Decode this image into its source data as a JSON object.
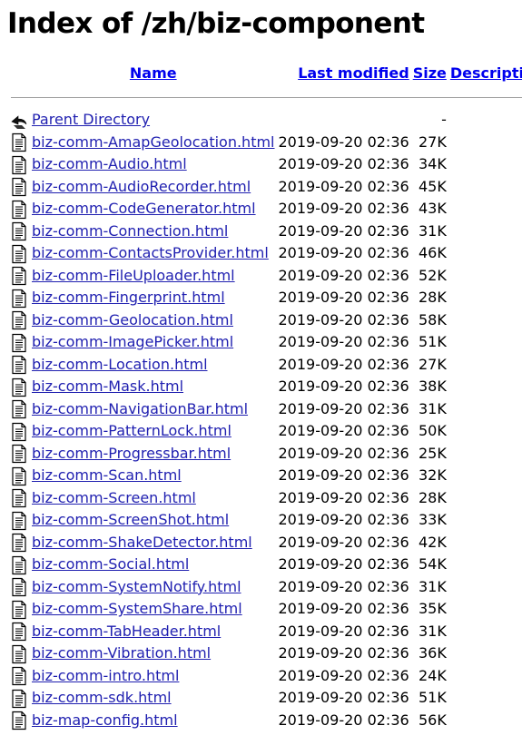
{
  "page": {
    "title": "Index of /zh/biz-component"
  },
  "columns": {
    "name": "Name",
    "last_modified": "Last modified",
    "size": "Size",
    "description": "Description"
  },
  "parent": {
    "label": "Parent Directory",
    "date": "",
    "size": "-",
    "icon": "back-arrow-icon"
  },
  "entries": [
    {
      "name": "biz-comm-AmapGeolocation.html",
      "date": "2019-09-20 02:36",
      "size": "27K",
      "icon": "text-file-icon"
    },
    {
      "name": "biz-comm-Audio.html",
      "date": "2019-09-20 02:36",
      "size": "34K",
      "icon": "text-file-icon"
    },
    {
      "name": "biz-comm-AudioRecorder.html",
      "date": "2019-09-20 02:36",
      "size": "45K",
      "icon": "text-file-icon"
    },
    {
      "name": "biz-comm-CodeGenerator.html",
      "date": "2019-09-20 02:36",
      "size": "43K",
      "icon": "text-file-icon"
    },
    {
      "name": "biz-comm-Connection.html",
      "date": "2019-09-20 02:36",
      "size": "31K",
      "icon": "text-file-icon"
    },
    {
      "name": "biz-comm-ContactsProvider.html",
      "date": "2019-09-20 02:36",
      "size": "46K",
      "icon": "text-file-icon"
    },
    {
      "name": "biz-comm-FileUploader.html",
      "date": "2019-09-20 02:36",
      "size": "52K",
      "icon": "text-file-icon"
    },
    {
      "name": "biz-comm-Fingerprint.html",
      "date": "2019-09-20 02:36",
      "size": "28K",
      "icon": "text-file-icon"
    },
    {
      "name": "biz-comm-Geolocation.html",
      "date": "2019-09-20 02:36",
      "size": "58K",
      "icon": "text-file-icon"
    },
    {
      "name": "biz-comm-ImagePicker.html",
      "date": "2019-09-20 02:36",
      "size": "51K",
      "icon": "text-file-icon"
    },
    {
      "name": "biz-comm-Location.html",
      "date": "2019-09-20 02:36",
      "size": "27K",
      "icon": "text-file-icon"
    },
    {
      "name": "biz-comm-Mask.html",
      "date": "2019-09-20 02:36",
      "size": "38K",
      "icon": "text-file-icon"
    },
    {
      "name": "biz-comm-NavigationBar.html",
      "date": "2019-09-20 02:36",
      "size": "31K",
      "icon": "text-file-icon"
    },
    {
      "name": "biz-comm-PatternLock.html",
      "date": "2019-09-20 02:36",
      "size": "50K",
      "icon": "text-file-icon"
    },
    {
      "name": "biz-comm-Progressbar.html",
      "date": "2019-09-20 02:36",
      "size": "25K",
      "icon": "text-file-icon"
    },
    {
      "name": "biz-comm-Scan.html",
      "date": "2019-09-20 02:36",
      "size": "32K",
      "icon": "text-file-icon"
    },
    {
      "name": "biz-comm-Screen.html",
      "date": "2019-09-20 02:36",
      "size": "28K",
      "icon": "text-file-icon"
    },
    {
      "name": "biz-comm-ScreenShot.html",
      "date": "2019-09-20 02:36",
      "size": "33K",
      "icon": "text-file-icon"
    },
    {
      "name": "biz-comm-ShakeDetector.html",
      "date": "2019-09-20 02:36",
      "size": "42K",
      "icon": "text-file-icon"
    },
    {
      "name": "biz-comm-Social.html",
      "date": "2019-09-20 02:36",
      "size": "54K",
      "icon": "text-file-icon"
    },
    {
      "name": "biz-comm-SystemNotify.html",
      "date": "2019-09-20 02:36",
      "size": "31K",
      "icon": "text-file-icon"
    },
    {
      "name": "biz-comm-SystemShare.html",
      "date": "2019-09-20 02:36",
      "size": "35K",
      "icon": "text-file-icon"
    },
    {
      "name": "biz-comm-TabHeader.html",
      "date": "2019-09-20 02:36",
      "size": "31K",
      "icon": "text-file-icon"
    },
    {
      "name": "biz-comm-Vibration.html",
      "date": "2019-09-20 02:36",
      "size": "36K",
      "icon": "text-file-icon"
    },
    {
      "name": "biz-comm-intro.html",
      "date": "2019-09-20 02:36",
      "size": "24K",
      "icon": "text-file-icon"
    },
    {
      "name": "biz-comm-sdk.html",
      "date": "2019-09-20 02:36",
      "size": "51K",
      "icon": "text-file-icon"
    },
    {
      "name": "biz-map-config.html",
      "date": "2019-09-20 02:36",
      "size": "56K",
      "icon": "text-file-icon"
    }
  ],
  "colors": {
    "link": "#1f1fb0",
    "header_link": "#0000ee",
    "rule": "#a0a0a0",
    "icon_stroke": "#000000",
    "back_icon_fill": "#000000"
  }
}
